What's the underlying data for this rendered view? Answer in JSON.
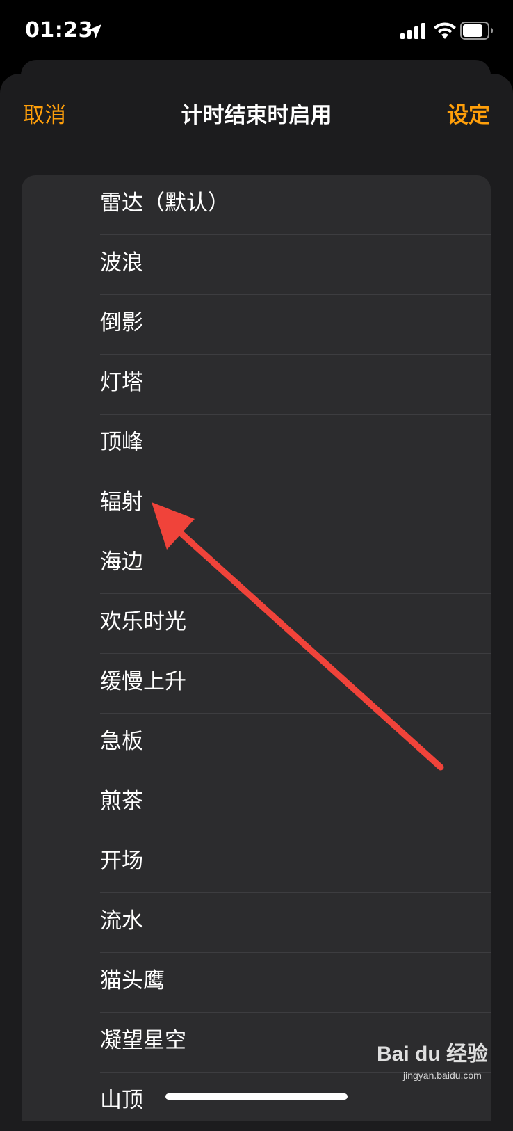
{
  "status_bar": {
    "time": "01:23",
    "location_icon": "location-arrow-icon",
    "signal_icon": "cellular-signal-icon",
    "wifi_icon": "wifi-icon",
    "battery_icon": "battery-icon"
  },
  "nav": {
    "cancel_label": "取消",
    "title": "计时结束时启用",
    "set_label": "设定"
  },
  "sounds": {
    "items": [
      "雷达（默认）",
      "波浪",
      "倒影",
      "灯塔",
      "顶峰",
      "辐射",
      "海边",
      "欢乐时光",
      "缓慢上升",
      "急板",
      "煎茶",
      "开场",
      "流水",
      "猫头鹰",
      "凝望星空",
      "山顶"
    ]
  },
  "annotation": {
    "arrow_icon": "red-arrow-annotation",
    "color": "#f0433a"
  },
  "watermark": {
    "logo": "Bai du 经验",
    "sub": "jingyan.baidu.com"
  },
  "colors": {
    "accent": "#ff9f0a",
    "background": "#000000",
    "sheet": "#1c1c1e",
    "list": "#2c2c2e"
  }
}
